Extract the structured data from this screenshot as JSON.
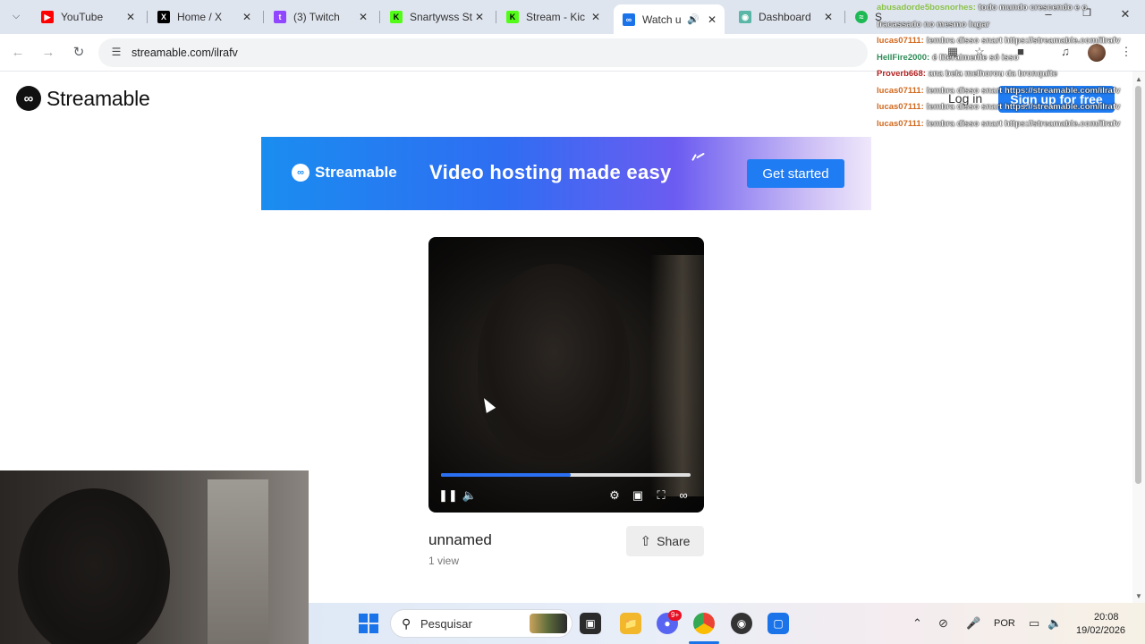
{
  "browser": {
    "tabs": [
      {
        "label": "YouTube",
        "icon": "youtube-icon",
        "color": "#ff0000",
        "active": false
      },
      {
        "label": "Home / X",
        "icon": "x-icon",
        "color": "#000000",
        "active": false
      },
      {
        "label": "(3) Twitch",
        "icon": "twitch-icon",
        "color": "#9146ff",
        "active": false
      },
      {
        "label": "Snartywss St",
        "icon": "kick-icon",
        "color": "#53fc18",
        "active": false
      },
      {
        "label": "Stream - Kic",
        "icon": "kick-icon",
        "color": "#53fc18",
        "active": false
      },
      {
        "label": "Watch u",
        "icon": "streamable-icon",
        "color": "#1a73e8",
        "active": true
      },
      {
        "label": "Dashboard",
        "icon": "dashboard-icon",
        "color": "#5ab6a6",
        "active": false
      },
      {
        "label": "S",
        "icon": "spotify-icon",
        "color": "#1db954",
        "active": false
      }
    ],
    "url": "streamable.com/ilrafv"
  },
  "site": {
    "brand": "Streamable",
    "login_label": "Log in",
    "signup_label": "Sign up for free"
  },
  "banner": {
    "brand": "Streamable",
    "headline": "Video hosting made easy",
    "cta": "Get started"
  },
  "video": {
    "title": "unnamed",
    "views": "1 view",
    "share_label": "Share",
    "progress": 0.52
  },
  "chat": [
    {
      "user": "abusadorde5bosnorhes:",
      "msg": "todo mundo crescendo e o",
      "color": "#8bc34a"
    },
    {
      "user": "",
      "msg": "fracassado no mesmo lugar",
      "color": "#ffffff"
    },
    {
      "user": "lucas07111:",
      "msg": "lembra disso snart https://streamable.com/ilrafv",
      "color": "#d2691e"
    },
    {
      "user": "HellFire2000:",
      "msg": "é literalmente só isso",
      "color": "#2e8b57"
    },
    {
      "user": "Proverb668:",
      "msg": "ana bela melhorou da bronquite",
      "color": "#b22222"
    },
    {
      "user": "lucas07111:",
      "msg": "lembra disso snart https://streamable.com/ilrafv",
      "color": "#d2691e"
    },
    {
      "user": "lucas07111:",
      "msg": "lembra disso snart https://streamable.com/ilrafv",
      "color": "#d2691e"
    },
    {
      "user": "lucas07111:",
      "msg": "lembra disso snart https://streamable.com/ilrafv",
      "color": "#d2691e"
    }
  ],
  "taskbar": {
    "search_placeholder": "Pesquisar",
    "language": "POR",
    "time": "20:08",
    "date": "19/02/2026",
    "badge": "9+"
  }
}
